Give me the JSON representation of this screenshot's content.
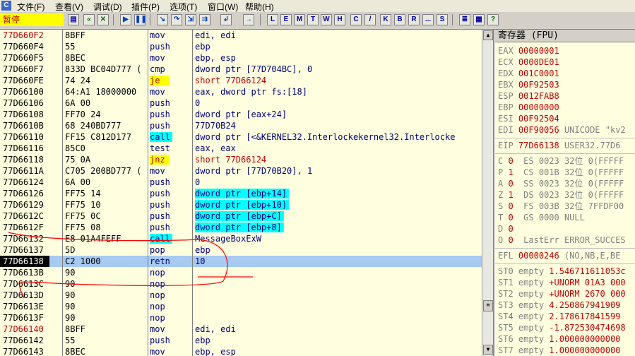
{
  "menu": {
    "items": [
      "文件(F)",
      "查看(V)",
      "调试(D)",
      "插件(P)",
      "选项(T)",
      "窗口(W)",
      "帮助(H)"
    ]
  },
  "status": "暂停",
  "toolbar": {
    "icons": [
      "open-icon",
      "restart-icon",
      "close-icon",
      "run-icon",
      "pause-icon",
      "step-into-icon",
      "step-over-icon",
      "trace-into-icon",
      "trace-over-icon",
      "execute-till-return-icon",
      "goto-icon"
    ],
    "letters": [
      "L",
      "E",
      "M",
      "T",
      "W",
      "H",
      "C",
      "/",
      "K",
      "B",
      "R",
      "...",
      "S"
    ],
    "tail_icons": [
      "list-icon",
      "grid-icon",
      "help-icon"
    ]
  },
  "colors": {
    "addr_red": "#c00000",
    "selection": "#a6caf0",
    "jump_highlight": "#ffff00",
    "call_highlight": "#00ffff",
    "mnemonic": "#000080",
    "jump_mnemonic": "#c00000",
    "annotation": "#ff0000"
  },
  "disasm": [
    {
      "addr": "77D660F2",
      "hex": "8BFF",
      "mn": "mov",
      "op": "edi, edi",
      "addr_red": true
    },
    {
      "addr": "77D660F4",
      "hex": "55",
      "mn": "push",
      "op": "ebp"
    },
    {
      "addr": "77D660F5",
      "hex": "8BEC",
      "mn": "mov",
      "op": "ebp, esp"
    },
    {
      "addr": "77D660F7",
      "hex": "833D BC04D777 (",
      "mn": "cmp",
      "op": "dword ptr [77D704BC], 0"
    },
    {
      "addr": "77D660FE",
      "hex": "74 24",
      "mn": "je",
      "op": "short 77D66124",
      "jump": true
    },
    {
      "addr": "77D66100",
      "hex": "64:A1 18000000",
      "mn": "mov",
      "op": "eax, dword ptr fs:[18]"
    },
    {
      "addr": "77D66106",
      "hex": "6A 00",
      "mn": "push",
      "op": "0"
    },
    {
      "addr": "77D66108",
      "hex": "FF70 24",
      "mn": "push",
      "op": "dword ptr [eax+24]"
    },
    {
      "addr": "77D6610B",
      "hex": "68 240BD777",
      "mn": "push",
      "op": "77D70B24"
    },
    {
      "addr": "77D66110",
      "hex": "FF15 C812D177",
      "mn": "call",
      "op": "dword ptr [<&KERNEL32.Interlockekernel32.Interlocke",
      "call": true
    },
    {
      "addr": "77D66116",
      "hex": "85C0",
      "mn": "test",
      "op": "eax, eax"
    },
    {
      "addr": "77D66118",
      "hex": "75 0A",
      "mn": "jnz",
      "op": "short 77D66124",
      "jump": true
    },
    {
      "addr": "77D6611A",
      "hex": "C705 200BD777 (",
      "mn": "mov",
      "op": "dword ptr [77D70B20], 1"
    },
    {
      "addr": "77D66124",
      "hex": "6A 00",
      "mn": "push",
      "op": "0"
    },
    {
      "addr": "77D66126",
      "hex": "FF75 14",
      "mn": "push",
      "op": "dword ptr [ebp+14]",
      "op_box": true
    },
    {
      "addr": "77D66129",
      "hex": "FF75 10",
      "mn": "push",
      "op": "dword ptr [ebp+10]",
      "op_box": true
    },
    {
      "addr": "77D6612C",
      "hex": "FF75 0C",
      "mn": "push",
      "op": "dword ptr [ebp+C]",
      "op_box": true
    },
    {
      "addr": "77D6612F",
      "hex": "FF75 08",
      "mn": "push",
      "op": "dword ptr [ebp+8]",
      "op_box": true
    },
    {
      "addr": "77D66132",
      "hex": "E8 01A4FEFF",
      "mn": "call",
      "op": "MessageBoxExW",
      "call": true
    },
    {
      "addr": "77D66137",
      "hex": "5D",
      "mn": "pop",
      "op": "ebp"
    },
    {
      "addr": "77D66138",
      "hex": "C2 1000",
      "mn": "retn",
      "op": "10",
      "selected": true
    },
    {
      "addr": "77D6613B",
      "hex": "90",
      "mn": "nop",
      "op": ""
    },
    {
      "addr": "77D6613C",
      "hex": "90",
      "mn": "nop",
      "op": ""
    },
    {
      "addr": "77D6613D",
      "hex": "90",
      "mn": "nop",
      "op": ""
    },
    {
      "addr": "77D6613E",
      "hex": "90",
      "mn": "nop",
      "op": ""
    },
    {
      "addr": "77D6613F",
      "hex": "90",
      "mn": "nop",
      "op": ""
    },
    {
      "addr": "77D66140",
      "hex": "8BFF",
      "mn": "mov",
      "op": "edi, edi",
      "addr_red": true
    },
    {
      "addr": "77D66142",
      "hex": "55",
      "mn": "push",
      "op": "ebp"
    },
    {
      "addr": "77D66143",
      "hex": "8BEC",
      "mn": "mov",
      "op": "ebp, esp"
    }
  ],
  "registers": {
    "title": "寄存器 (FPU)",
    "general": [
      {
        "name": "EAX",
        "value": "00000001",
        "comment": ""
      },
      {
        "name": "ECX",
        "value": "0000DE01",
        "comment": ""
      },
      {
        "name": "EDX",
        "value": "001C0001",
        "comment": ""
      },
      {
        "name": "EBX",
        "value": "00F92503",
        "comment": ""
      },
      {
        "name": "ESP",
        "value": "0012FAB8",
        "comment": ""
      },
      {
        "name": "EBP",
        "value": "00000000",
        "comment": ""
      },
      {
        "name": "ESI",
        "value": "00F92504",
        "comment": ""
      },
      {
        "name": "EDI",
        "value": "00F90056",
        "comment": "UNICODE \"kv2"
      }
    ],
    "eip": {
      "name": "EIP",
      "value": "77D66138",
      "comment": "USER32.77D6"
    },
    "flags": [
      {
        "flag": "C",
        "bit": "0",
        "seg": "ES",
        "sel": "0023",
        "rest": "32位 0(FFFFF"
      },
      {
        "flag": "P",
        "bit": "1",
        "seg": "CS",
        "sel": "001B",
        "rest": "32位 0(FFFFF"
      },
      {
        "flag": "A",
        "bit": "0",
        "seg": "SS",
        "sel": "0023",
        "rest": "32位 0(FFFFF"
      },
      {
        "flag": "Z",
        "bit": "1",
        "seg": "DS",
        "sel": "0023",
        "rest": "32位 0(FFFFF"
      },
      {
        "flag": "S",
        "bit": "0",
        "seg": "FS",
        "sel": "003B",
        "rest": "32位 7FFDF00"
      },
      {
        "flag": "T",
        "bit": "0",
        "seg": "GS",
        "sel": "0000",
        "rest": "NULL"
      },
      {
        "flag": "D",
        "bit": "0",
        "seg": "",
        "sel": "",
        "rest": ""
      },
      {
        "flag": "O",
        "bit": "0",
        "seg": "",
        "sel": "",
        "rest": "LastErr ERROR_SUCCES"
      }
    ],
    "efl": {
      "name": "EFL",
      "value": "00000246",
      "comment": "(NO,NB,E,BE"
    },
    "fpu": [
      {
        "name": "ST0",
        "tag": "empty",
        "value": "1.546711611053c"
      },
      {
        "name": "ST1",
        "tag": "empty",
        "value": "+UNORM 01A3 000"
      },
      {
        "name": "ST2",
        "tag": "empty",
        "value": "+UNORM 2670 000"
      },
      {
        "name": "ST3",
        "tag": "empty",
        "value": "4.250867941909"
      },
      {
        "name": "ST4",
        "tag": "empty",
        "value": "2.178617841599"
      },
      {
        "name": "ST5",
        "tag": "empty",
        "value": "-1.872530474698"
      },
      {
        "name": "ST6",
        "tag": "empty",
        "value": "1.000000000000"
      },
      {
        "name": "ST7",
        "tag": "empty",
        "value": "1.000000000000"
      }
    ]
  },
  "scroll": {
    "up": "▲",
    "down": "▼"
  }
}
